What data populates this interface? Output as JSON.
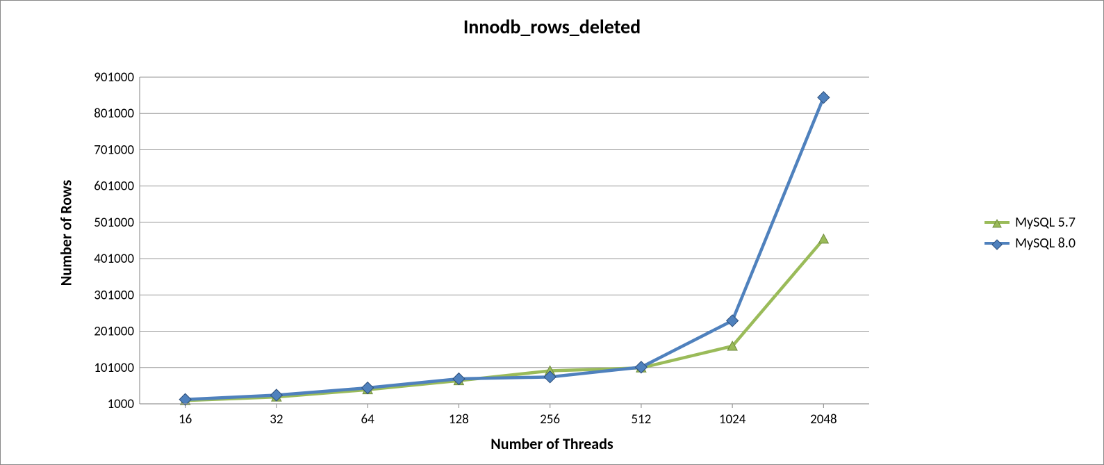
{
  "chart_data": {
    "type": "line",
    "title": "Innodb_rows_deleted",
    "xlabel": "Number of Threads",
    "ylabel": "Number of Rows",
    "categories": [
      "16",
      "32",
      "64",
      "128",
      "256",
      "512",
      "1024",
      "2048"
    ],
    "y_ticks": [
      1000,
      101000,
      201000,
      301000,
      401000,
      501000,
      601000,
      701000,
      801000,
      901000
    ],
    "ylim": [
      1000,
      901000
    ],
    "series": [
      {
        "name": "MySQL 5.7",
        "color": "#9ABB59",
        "marker": "triangle",
        "values": [
          10000,
          20000,
          40000,
          65000,
          92000,
          100000,
          160000,
          455000
        ]
      },
      {
        "name": "MySQL 8.0",
        "color": "#4F81BD",
        "marker": "diamond",
        "values": [
          13000,
          25000,
          45000,
          70000,
          75000,
          102000,
          230000,
          845000
        ]
      }
    ],
    "legend_position": "right",
    "grid": true
  }
}
